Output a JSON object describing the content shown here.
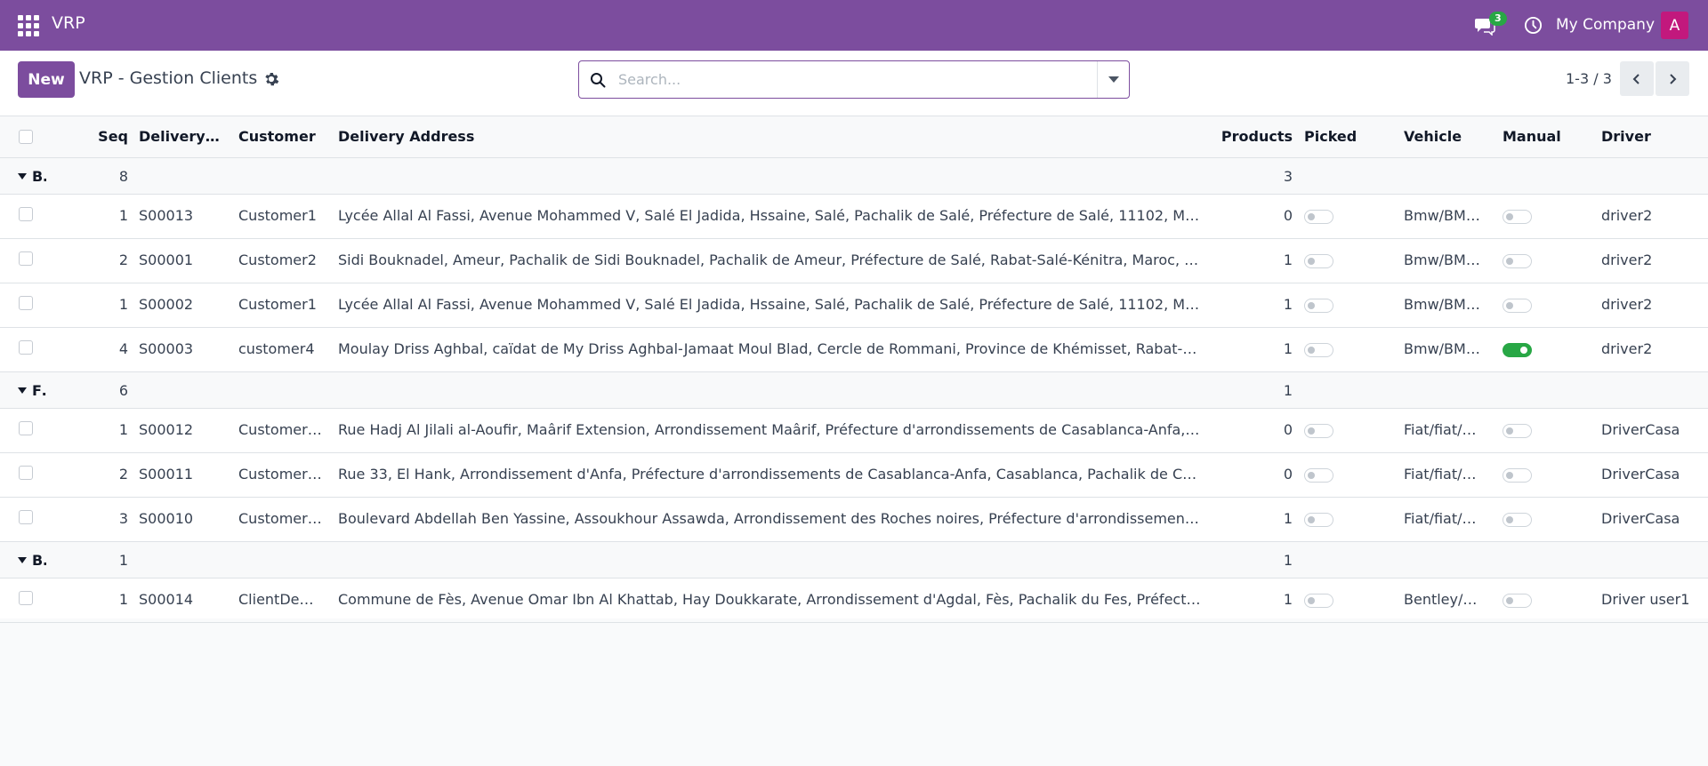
{
  "navbar": {
    "app_name": "VRP",
    "chat_count": "3",
    "company": "My Company",
    "avatar_letter": "A"
  },
  "control_panel": {
    "new_label": "New",
    "breadcrumb": "VRP - Gestion Clients",
    "search_placeholder": "Search...",
    "pager": "1-3 / 3"
  },
  "columns": {
    "seq": "Seq",
    "delivery": "Delivery ...",
    "customer": "Customer",
    "address": "Delivery Address",
    "products": "Products",
    "picked": "Picked",
    "vehicle": "Vehicle",
    "manual": "Manual",
    "driver": "Driver"
  },
  "groups": [
    {
      "name": "Bı",
      "seq_sum": "8",
      "products_sum": "3",
      "rows": [
        {
          "seq": "1",
          "delivery": "S00013",
          "customer": "Customer1",
          "address": "Lycée Allal Al Fassi, Avenue Mohammed V, Salé El Jadida, Hssaine, Salé, Pachalik de Salé, Préfecture de Salé, 11102, Maro…",
          "products": "0",
          "picked": false,
          "vehicle": "Bmw/BM…",
          "manual": false,
          "driver": "driver2"
        },
        {
          "seq": "2",
          "delivery": "S00001",
          "customer": "Customer2",
          "address": "Sidi Bouknadel, Ameur, Pachalik de Sidi Bouknadel, Pachalik de Ameur, Préfecture de Salé, Rabat-Salé-Kénitra, Maroc, Am…",
          "products": "1",
          "picked": false,
          "vehicle": "Bmw/BM…",
          "manual": false,
          "driver": "driver2"
        },
        {
          "seq": "1",
          "delivery": "S00002",
          "customer": "Customer1",
          "address": "Lycée Allal Al Fassi, Avenue Mohammed V, Salé El Jadida, Hssaine, Salé, Pachalik de Salé, Préfecture de Salé, 11102, Maro…",
          "products": "1",
          "picked": false,
          "vehicle": "Bmw/BM…",
          "manual": false,
          "driver": "driver2"
        },
        {
          "seq": "4",
          "delivery": "S00003",
          "customer": "customer4",
          "address": "Moulay Driss Aghbal, caïdat de My Driss Aghbal-Jamaat Moul Blad, Cercle de Rommani, Province de Khémisset, Rabat-Sal…",
          "products": "1",
          "picked": false,
          "vehicle": "Bmw/BM…",
          "manual": true,
          "driver": "driver2"
        }
      ]
    },
    {
      "name": "Fi",
      "seq_sum": "6",
      "products_sum": "1",
      "rows": [
        {
          "seq": "1",
          "delivery": "S00012",
          "customer": "Customer…",
          "address": "Rue Hadj Al Jilali al-Aoufir, Maârif Extension, Arrondissement Maârif, Préfecture d'arrondissements de Casablanca-Anfa, …",
          "products": "0",
          "picked": false,
          "vehicle": "Fiat/fiat/…",
          "manual": false,
          "driver": "DriverCasa"
        },
        {
          "seq": "2",
          "delivery": "S00011",
          "customer": "Customer…",
          "address": "Rue 33, El Hank, Arrondissement d'Anfa, Préfecture d'arrondissements de Casablanca-Anfa, Casablanca, Pachalik de Casa…",
          "products": "0",
          "picked": false,
          "vehicle": "Fiat/fiat/…",
          "manual": false,
          "driver": "DriverCasa"
        },
        {
          "seq": "3",
          "delivery": "S00010",
          "customer": "Customer…",
          "address": "Boulevard Abdellah Ben Yassine, Assoukhour Assawda, Arrondissement des Roches noires, Préfecture d'arrondissement…",
          "products": "1",
          "picked": false,
          "vehicle": "Fiat/fiat/…",
          "manual": false,
          "driver": "DriverCasa"
        }
      ]
    },
    {
      "name": "Bε",
      "seq_sum": "1",
      "products_sum": "1",
      "rows": [
        {
          "seq": "1",
          "delivery": "S00014",
          "customer": "ClientDe…",
          "address": "Commune de Fès, Avenue Omar Ibn Al Khattab, Hay Doukkarate, Arrondissement d'Agdal, Fès, Pachalik du Fes, Préfectur…",
          "products": "1",
          "picked": false,
          "vehicle": "Bentley/b…",
          "manual": false,
          "driver": "Driver user1"
        }
      ]
    }
  ]
}
